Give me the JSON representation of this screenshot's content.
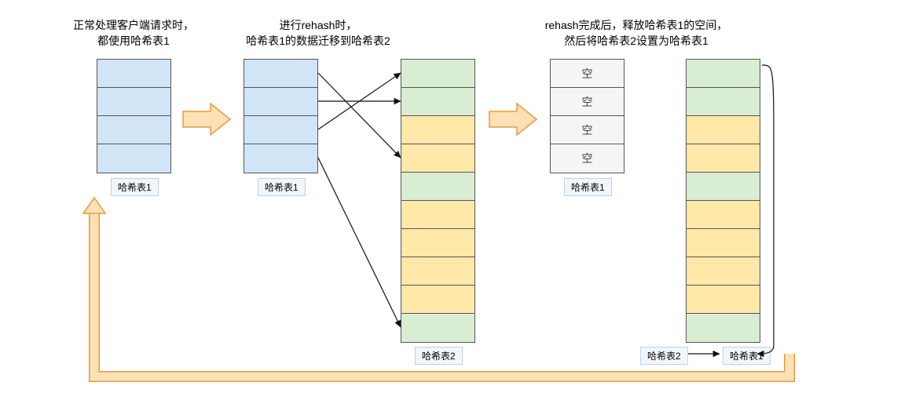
{
  "captions": {
    "stage1": "正常处理客户端请求时，\n都使用哈希表1",
    "stage2": "进行rehash时，\n哈希表1的数据迁移到哈希表2",
    "stage3": "rehash完成后，释放哈希表1的空间，\n然后将哈希表2设置为哈希表1"
  },
  "labels": {
    "table1": "哈希表1",
    "table2": "哈希表2",
    "empty": "空"
  },
  "colors": {
    "blue": "#d1e5f6",
    "yellow": "#ffe8a8",
    "green": "#d9edd3",
    "arrow_fill": "#fce1b7",
    "arrow_stroke": "#e69a3a"
  },
  "tables": {
    "stage1_t1": {
      "rows": 4,
      "pattern": [
        "blue",
        "blue",
        "blue",
        "blue"
      ]
    },
    "stage2_t1": {
      "rows": 4,
      "pattern": [
        "blue",
        "blue",
        "blue",
        "blue"
      ]
    },
    "stage2_t2": {
      "rows": 10,
      "pattern": [
        "green",
        "green",
        "yellow",
        "yellow",
        "green",
        "yellow",
        "yellow",
        "yellow",
        "yellow",
        "green"
      ]
    },
    "stage3_t1": {
      "rows": 4,
      "pattern": [
        "empty",
        "empty",
        "empty",
        "empty"
      ]
    },
    "stage3_t2": {
      "rows": 10,
      "pattern": [
        "green",
        "green",
        "yellow",
        "yellow",
        "green",
        "yellow",
        "yellow",
        "yellow",
        "yellow",
        "green"
      ]
    }
  },
  "migrations": [
    {
      "from_row": 0,
      "to_row": 3
    },
    {
      "from_row": 1,
      "to_row": 1
    },
    {
      "from_row": 2,
      "to_row": 0
    },
    {
      "from_row": 3,
      "to_row": 9
    }
  ]
}
